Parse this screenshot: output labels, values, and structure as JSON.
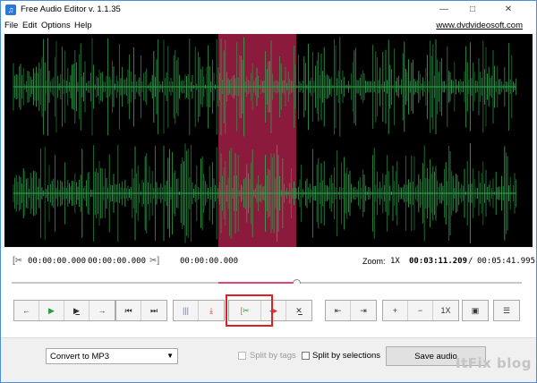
{
  "window": {
    "title": "Free Audio Editor v. 1.1.35",
    "minimize": "—",
    "maximize": "□",
    "close": "✕"
  },
  "menu": {
    "items": [
      "File",
      "Edit",
      "Options",
      "Help"
    ],
    "site_link": "www.dvdvideosoft.com"
  },
  "timeline": {
    "selection_start": "00:00:00.000",
    "selection_end": "00:00:00.000",
    "cut_time": "00:00:00.000",
    "zoom_label": "Zoom:",
    "zoom_value": "1X",
    "current_time": "00:03:11.209",
    "separator": "/",
    "total_time": "00:05:41.995",
    "selection_start_fraction": 0.4,
    "selection_end_fraction": 0.55,
    "playhead_fraction": 0.55
  },
  "toolbar": {
    "zoom_reset_label": "1X",
    "playback": [
      "step-back-icon",
      "play-icon",
      "play-selection-icon",
      "step-forward-icon"
    ],
    "navigation": [
      "skip-start-icon",
      "skip-end-icon"
    ],
    "markers": [
      "split-marker-icon",
      "down-marker-icon"
    ],
    "edit": [
      "cut-icon",
      "paste-icon",
      "delete-icon"
    ],
    "jump": [
      "go-start-icon",
      "go-end-icon"
    ],
    "zoom": [
      "zoom-in-icon",
      "zoom-out-icon"
    ],
    "extra": [
      "image-icon",
      "settings-icon"
    ]
  },
  "bottom": {
    "format_select": "Convert to MP3",
    "split_by_tags": "Split by tags",
    "split_by_selections": "Split by selections",
    "save_button": "Save audio"
  },
  "watermark": "ItFix blog",
  "colors": {
    "wave": "#2fa84f",
    "selection": "#8b1a3c",
    "accent": "#e0457b",
    "highlight": "#e02020"
  }
}
